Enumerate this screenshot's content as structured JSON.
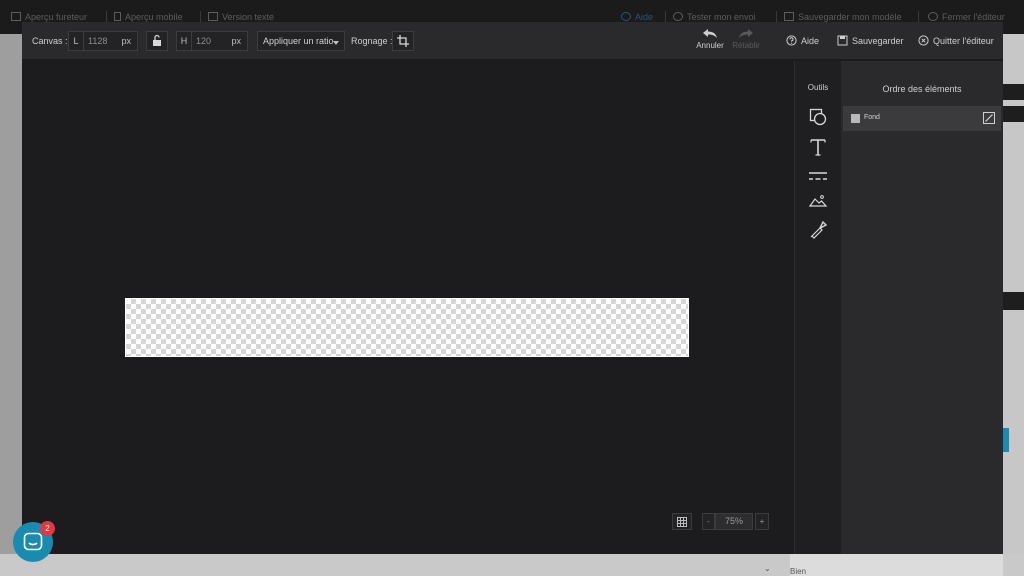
{
  "app_bar": {
    "items": [
      {
        "label": "Aperçu fureteur",
        "icon": "monitor-icon"
      },
      {
        "label": "Aperçu mobile",
        "icon": "mobile-icon"
      },
      {
        "label": "Version texte",
        "icon": "text-version-icon"
      },
      {
        "label": "Aide",
        "icon": "help-icon"
      },
      {
        "label": "Tester mon envoi",
        "icon": "check-icon"
      },
      {
        "label": "Sauvegarder mon modèle",
        "icon": "save-icon"
      },
      {
        "label": "Fermer l'éditeur",
        "icon": "close-icon"
      }
    ]
  },
  "toolbar": {
    "canvas_label": "Canvas :",
    "width_prefix": "L",
    "width_value": "1128",
    "width_unit": "px",
    "height_prefix": "H",
    "height_value": "120",
    "height_unit": "px",
    "ratio_select": "Appliquer un ratio",
    "crop_label": "Rognage :",
    "undo_label": "Annuler",
    "redo_label": "Rétablir",
    "help_label": "Aide",
    "save_label": "Sauvegarder",
    "quit_label": "Quitter l'éditeur"
  },
  "tools": {
    "title": "Outils",
    "items": [
      "shapes-icon",
      "text-icon",
      "lines-icon",
      "image-icon",
      "eyedropper-icon"
    ]
  },
  "layers": {
    "title": "Ordre des éléments",
    "items": [
      {
        "name": "Fond",
        "color": "#b9b9b9"
      }
    ]
  },
  "zoom": {
    "decrease": "-",
    "value": "75%",
    "increase": "+"
  },
  "background": {
    "bottom_text": "Bien"
  },
  "chat": {
    "badge_count": "2"
  },
  "colors": {
    "editor_bg": "#1c1c1e",
    "panel_bg": "#2a2a2c",
    "accent": "#1a8bb0",
    "badge": "#e5373f"
  }
}
